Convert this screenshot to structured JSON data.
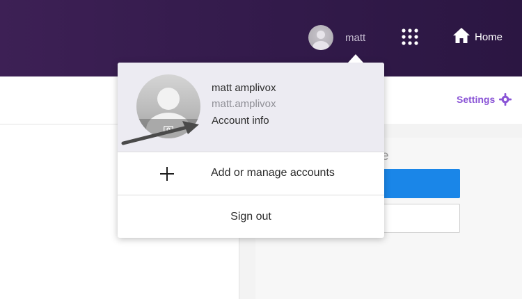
{
  "topbar": {
    "user_label": "matt",
    "avatar_icon": "user-avatar-icon",
    "apps_icon": "apps-grid-icon",
    "home_icon": "home-icon",
    "home_label": "Home",
    "background_color": "#321a4a"
  },
  "subheader": {
    "settings_label": "Settings",
    "settings_icon": "gear-icon",
    "accent_color": "#8a54d6"
  },
  "background_panel": {
    "peek_text": "e",
    "primary_button_color": "#1a86e8"
  },
  "account_menu": {
    "display_name": "matt amplivox",
    "username": "matt.amplivox",
    "account_info_label": "Account info",
    "avatar_icon": "user-avatar-icon",
    "camera_icon": "camera-icon",
    "add_icon": "plus-icon",
    "add_accounts_label": "Add or manage accounts",
    "sign_out_label": "Sign out"
  },
  "annotation": {
    "arrow_icon": "annotation-arrow-icon",
    "color": "#4a4a4a"
  }
}
